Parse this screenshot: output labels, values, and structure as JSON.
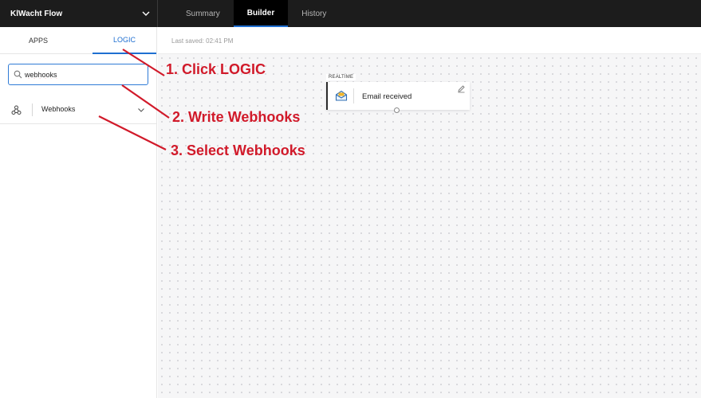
{
  "app": {
    "flow_name": "KlWacht Flow",
    "tabs": [
      {
        "label": "Summary",
        "active": false
      },
      {
        "label": "Builder",
        "active": true
      },
      {
        "label": "History",
        "active": false
      }
    ]
  },
  "sidebar": {
    "tabs": [
      {
        "label": "APPS",
        "active": false
      },
      {
        "label": "LOGIC",
        "active": true
      }
    ],
    "search": {
      "value": "webhooks",
      "placeholder": ""
    },
    "results": [
      {
        "label": "Webhooks",
        "icon": "webhook-icon"
      }
    ]
  },
  "canvas": {
    "last_saved": "Last saved: 02:41 PM",
    "node": {
      "badge": "REALTIME",
      "label": "Email received",
      "icon": "email-envelope-icon"
    }
  },
  "annotations": [
    {
      "text": "1. Click LOGIC"
    },
    {
      "text": "2. Write Webhooks"
    },
    {
      "text": "3. Select Webhooks"
    }
  ],
  "colors": {
    "topbar_bg": "#1c1c1c",
    "accent": "#1f6fd1",
    "annotation": "#d11a2a",
    "canvas_bg": "#f6f6f7"
  }
}
